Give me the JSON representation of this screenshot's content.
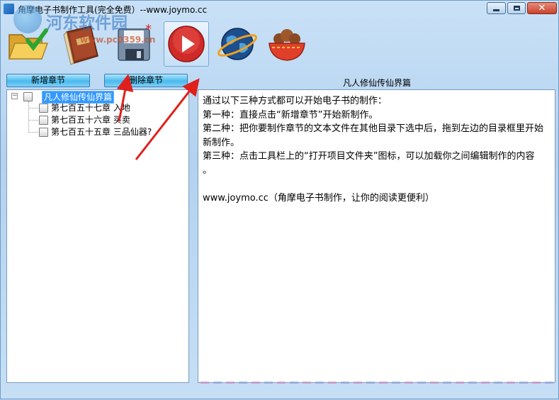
{
  "window": {
    "title": "角摩电子书制作工具(完全免费）--www.joymo.cc",
    "controls": {
      "minimize": "–",
      "maximize": "□",
      "close": "✕"
    }
  },
  "watermark": {
    "site_name": "河东软件园",
    "url": "www.pc0359.cn"
  },
  "toolbar": {
    "items": [
      {
        "icon": "open-folder-icon"
      },
      {
        "icon": "book-icon"
      },
      {
        "icon": "save-disk-icon"
      },
      {
        "icon": "play-icon",
        "active": true
      },
      {
        "icon": "globe-icon"
      },
      {
        "icon": "food-bowl-icon"
      }
    ]
  },
  "buttons": {
    "add_chapter": "新增章节",
    "delete_chapter": "删除章节"
  },
  "document": {
    "title": "凡人修仙传仙界篇"
  },
  "tree": {
    "root": {
      "label": "凡人修仙传仙界篇",
      "expander": "−",
      "selected": true
    },
    "items": [
      {
        "label": "第七百五十七章  入地"
      },
      {
        "label": "第七百五十六章  买卖"
      },
      {
        "label": "第七百五十五章  三品仙器?"
      }
    ]
  },
  "content": {
    "lines": [
      "通过以下三种方式都可以开始电子书的制作：",
      "第一种：直接点击“新增章节”开始新制作。",
      "第二种：把你要制作章节的文本文件在其他目录下选中后，拖到左边的目录框里开始",
      "新制作。",
      "第三种：点击工具栏上的“打开项目文件夹”图标，可以加载你之间编辑制作的内容",
      "。",
      "",
      "www.joymo.cc（角摩电子书制作，让你的阅读更便利）"
    ]
  },
  "colors": {
    "accent_button": "#49b9ee",
    "selection": "#3399ff",
    "annotation_arrow": "#e0201c",
    "window_bg": "#b9d7f2"
  }
}
